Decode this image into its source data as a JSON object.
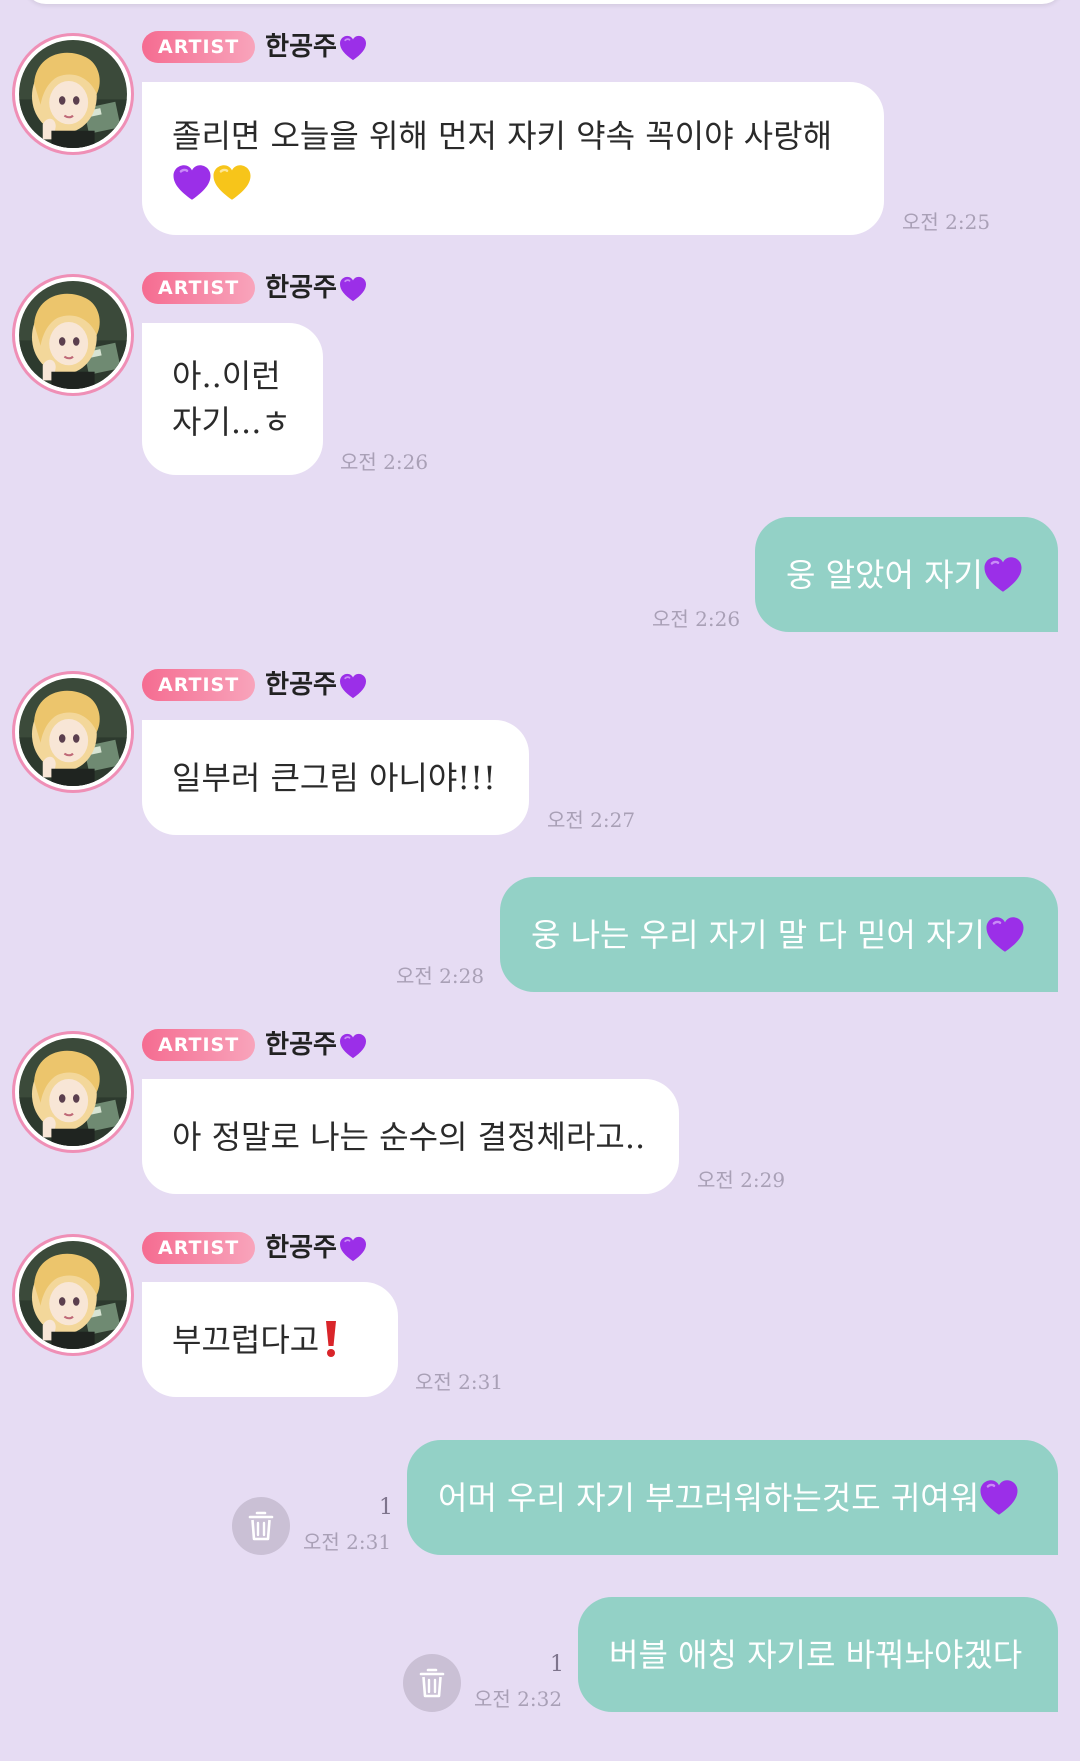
{
  "sender": {
    "badge": "ARTIST",
    "name": "한공주"
  },
  "colors": {
    "background": "#e6dcf3",
    "incoming_bubble": "#ffffff",
    "outgoing_bubble": "#93d1c6",
    "badge_gradient_start": "#f56c91",
    "badge_gradient_end": "#f8a4bb",
    "avatar_ring": "#ef8fb6",
    "heart": "#9b2fe8"
  },
  "messages": [
    {
      "direction": "in",
      "lines": [
        "졸리면 오늘을 위해 먼저 자키 약속 꼭이야 사랑해"
      ],
      "emoji": [
        "purple-heart",
        "yellow-heart"
      ],
      "time": "오전 2:25"
    },
    {
      "direction": "in",
      "lines": [
        "아..이런",
        "자기...ㅎ"
      ],
      "time": "오전 2:26"
    },
    {
      "direction": "out",
      "text": "웅 알았어 자기",
      "emoji": [
        "purple-heart"
      ],
      "time": "오전 2:26"
    },
    {
      "direction": "in",
      "lines": [
        "일부러 큰그림 아니야!!!"
      ],
      "time": "오전 2:27"
    },
    {
      "direction": "out",
      "text": "웅 나는 우리 자기 말 다 믿어 자기",
      "emoji": [
        "purple-heart"
      ],
      "time": "오전 2:28"
    },
    {
      "direction": "in",
      "lines": [
        "아 정말로 나는 순수의 결정체라고.."
      ],
      "time": "오전 2:29"
    },
    {
      "direction": "in",
      "lines": [
        "부끄럽다고"
      ],
      "emoji": [
        "red-exclamation"
      ],
      "time": "오전 2:31"
    },
    {
      "direction": "out",
      "text": "어머 우리 자기 부끄러워하는것도 귀여워",
      "emoji": [
        "purple-heart"
      ],
      "time": "오전 2:31",
      "unread": "1",
      "icon": "trash-icon"
    },
    {
      "direction": "out",
      "text": "버블 애칭 자기로 바꿔놔야겠다",
      "time": "오전 2:32",
      "unread": "1",
      "icon": "trash-icon"
    }
  ]
}
